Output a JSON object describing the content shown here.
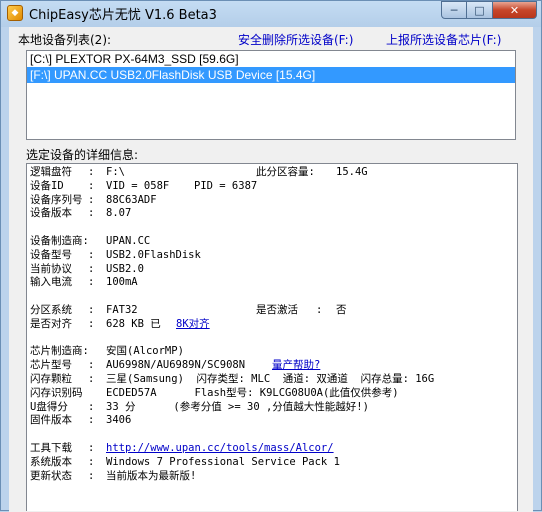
{
  "window": {
    "title": "ChipEasy芯片无忧 V1.6 Beta3",
    "min_glyph": "─",
    "max_glyph": "□",
    "close_glyph": "✕"
  },
  "top": {
    "local_label": "本地设备列表(2):",
    "delete_link": "安全删除所选设备(F:)",
    "report_link": "上报所选设备芯片(F:)"
  },
  "devices": [
    "[C:\\] PLEXTOR PX-64M3_SSD [59.6G]",
    "[F:\\] UPAN.CC USB2.0FlashDisk USB Device [15.4G]"
  ],
  "detail_label": "选定设备的详细信息:",
  "details": {
    "logical_drive_key": "逻辑盘符",
    "logical_drive_val": "F:\\",
    "partition_cap_key": "此分区容量:",
    "partition_cap_val": "15.4G",
    "device_id_key": "设备ID",
    "vid": "VID = 058F",
    "pid": "PID = 6387",
    "serial_key": "设备序列号",
    "serial_val": "88C63ADF",
    "version_key": "设备版本",
    "version_val": "8.07",
    "maker_key": "设备制造商:",
    "maker_val": "UPAN.CC",
    "model_key": "设备型号",
    "model_val": "USB2.0FlashDisk",
    "protocol_key": "当前协议",
    "protocol_val": "USB2.0",
    "current_key": "输入电流",
    "current_val": "100mA",
    "fs_key": "分区系统",
    "fs_val": "FAT32",
    "active_key": "是否激活",
    "active_val": "否",
    "align_key": "是否对齐",
    "align_val": "628 KB 已",
    "align_link": "8K对齐",
    "chip_maker_key": "芯片制造商:",
    "chip_maker_val": "安国(AlcorMP)",
    "chip_model_key": "芯片型号",
    "chip_model_val": "AU6998N/AU6989N/SC908N",
    "chip_model_link": "量产帮助?",
    "flash_key": "闪存颗粒",
    "flash_val": "三星(Samsung)  闪存类型: MLC  通道: 双通道  闪存总量: 16G",
    "flash_id_key": "闪存识别码",
    "flash_id_val": "ECDED57A      Flash型号: K9LCG08U0A(此值仅供参考)",
    "score_key": "U盘得分",
    "score_val": "33 分      (参考分值 >= 30 ,分值越大性能越好!)",
    "firmware_key": "固件版本",
    "firmware_val": "3406",
    "tool_key": "工具下载",
    "tool_link": "http://www.upan.cc/tools/mass/Alcor/",
    "os_key": "系统版本",
    "os_val": "Windows 7 Professional Service Pack 1",
    "update_key": "更新状态",
    "update_val": "当前版本为最新版!",
    "colon": ":"
  }
}
